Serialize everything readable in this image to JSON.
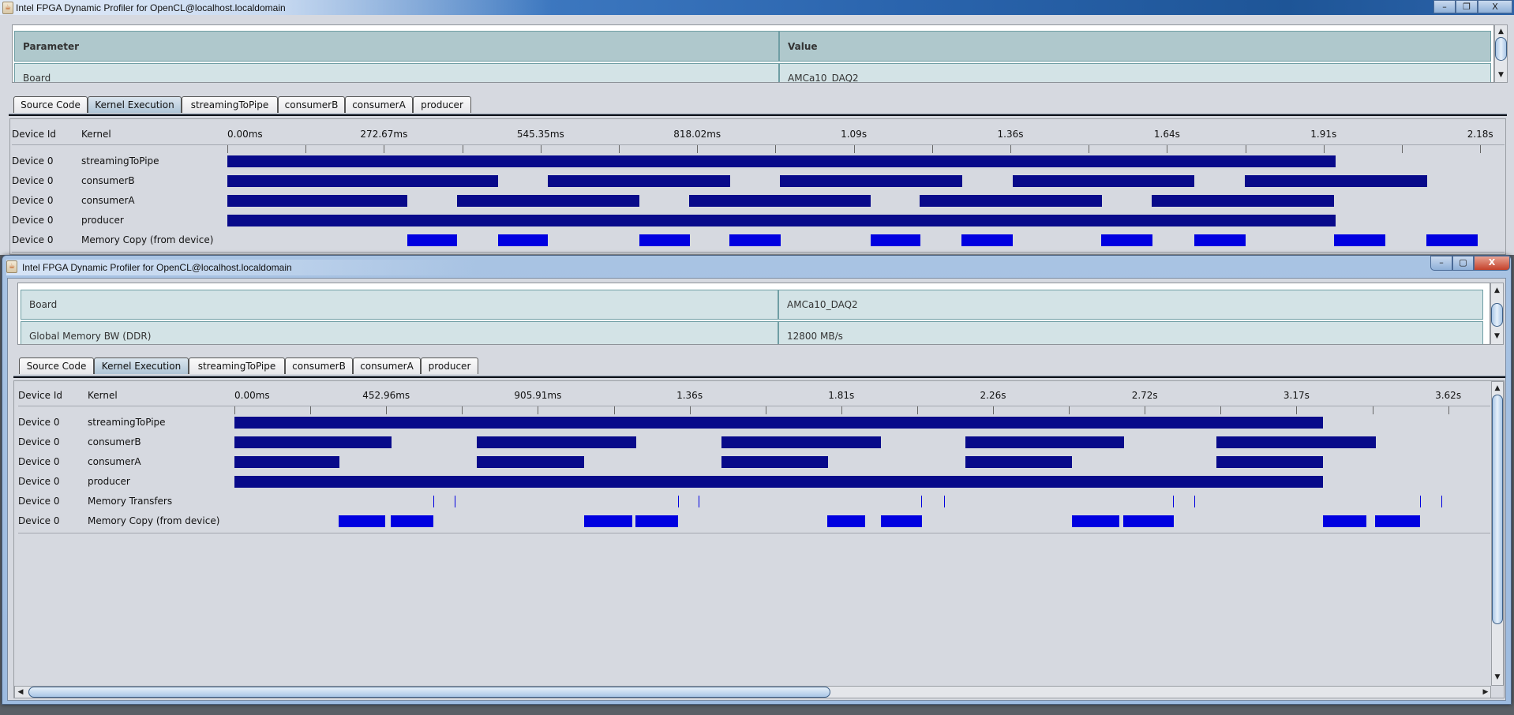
{
  "colors": {
    "kernel_bar": "#080a8a",
    "memory_bar": "#0000e0",
    "table_header": "#afc8cc",
    "table_row": "#d3e3e6"
  },
  "windows": [
    {
      "title": "Intel FPGA Dynamic Profiler for OpenCL@localhost.localdomain",
      "controls": {
        "minimize": "–",
        "maximize": "❐",
        "close": "X"
      },
      "table": {
        "headers": [
          "Parameter",
          "Value"
        ],
        "rows": [
          [
            "Board",
            "AMCa10_DAQ2"
          ]
        ]
      },
      "tabs": [
        {
          "label": "Source Code",
          "active": false
        },
        {
          "label": "Kernel Execution",
          "active": true
        },
        {
          "label": "streamingToPipe",
          "active": false
        },
        {
          "label": "consumerB",
          "active": false
        },
        {
          "label": "consumerA",
          "active": false
        },
        {
          "label": "producer",
          "active": false
        }
      ],
      "timeline": {
        "col_device": "Device Id",
        "col_kernel": "Kernel",
        "tick_ms": 136.335,
        "tick_count": 16,
        "axis_labels": [
          "0.00ms",
          "272.67ms",
          "545.35ms",
          "818.02ms",
          "1.09s",
          "1.36s",
          "1.64s",
          "1.91s",
          "2.18s"
        ],
        "rows": [
          {
            "device": "Device 0",
            "kernel": "streamingToPipe",
            "kind": "bar",
            "segments": [
              [
                0,
                1930
              ]
            ]
          },
          {
            "device": "Device 0",
            "kernel": "consumerB",
            "kind": "bar",
            "segments": [
              [
                0,
                472
              ],
              [
                558,
                875
              ],
              [
                962,
                1279
              ],
              [
                1367,
                1683
              ],
              [
                1771,
                2088
              ]
            ]
          },
          {
            "device": "Device 0",
            "kernel": "consumerA",
            "kind": "bar",
            "segments": [
              [
                0,
                314
              ],
              [
                400,
                717
              ],
              [
                804,
                1120
              ],
              [
                1205,
                1522
              ],
              [
                1610,
                1927
              ]
            ]
          },
          {
            "device": "Device 0",
            "kernel": "producer",
            "kind": "bar",
            "segments": [
              [
                0,
                1930
              ]
            ]
          },
          {
            "device": "Device 0",
            "kernel": "Memory Copy (from device)",
            "kind": "copy",
            "segments": [
              [
                314,
                401
              ],
              [
                472,
                559
              ],
              [
                717,
                805
              ],
              [
                874,
                963
              ],
              [
                1120,
                1206
              ],
              [
                1278,
                1368
              ],
              [
                1522,
                1611
              ],
              [
                1683,
                1772
              ],
              [
                1927,
                2016
              ],
              [
                2088,
                2177
              ]
            ]
          }
        ]
      }
    },
    {
      "title": "Intel FPGA Dynamic Profiler for OpenCL@localhost.localdomain",
      "controls": {
        "minimize": "–",
        "maximize": "▢",
        "close": "X"
      },
      "table": {
        "rows": [
          [
            "Board",
            "AMCa10_DAQ2"
          ],
          [
            "Global Memory BW (DDR)",
            "12800 MB/s"
          ]
        ]
      },
      "tabs": [
        {
          "label": "Source Code",
          "active": false
        },
        {
          "label": "Kernel Execution",
          "active": true
        },
        {
          "label": "streamingToPipe",
          "active": false
        },
        {
          "label": "consumerB",
          "active": false
        },
        {
          "label": "consumerA",
          "active": false
        },
        {
          "label": "producer",
          "active": false
        }
      ],
      "timeline": {
        "col_device": "Device Id",
        "col_kernel": "Kernel",
        "tick_ms": 226.48,
        "tick_count": 16,
        "axis_labels": [
          "0.00ms",
          "452.96ms",
          "905.91ms",
          "1.36s",
          "1.81s",
          "2.26s",
          "2.72s",
          "3.17s",
          "3.62s"
        ],
        "rows": [
          {
            "device": "Device 0",
            "kernel": "streamingToPipe",
            "kind": "bar",
            "segments": [
              [
                0,
                3249
              ]
            ]
          },
          {
            "device": "Device 0",
            "kernel": "consumerB",
            "kind": "bar",
            "segments": [
              [
                0,
                469
              ],
              [
                724,
                1199
              ],
              [
                1454,
                1930
              ],
              [
                2182,
                2656
              ],
              [
                2931,
                3407
              ]
            ]
          },
          {
            "device": "Device 0",
            "kernel": "consumerA",
            "kind": "bar",
            "segments": [
              [
                0,
                313
              ],
              [
                724,
                1044
              ],
              [
                1454,
                1772
              ],
              [
                2182,
                2500
              ],
              [
                2931,
                3249
              ]
            ]
          },
          {
            "device": "Device 0",
            "kernel": "producer",
            "kind": "bar",
            "segments": [
              [
                0,
                3249
              ]
            ]
          },
          {
            "device": "Device 0",
            "kernel": "Memory Transfers",
            "kind": "xfer",
            "marks": [
              594,
              657,
              1324,
              1386,
              2050,
              2118,
              2802,
              2865,
              3539,
              3603
            ]
          },
          {
            "device": "Device 0",
            "kernel": "Memory Copy (from device)",
            "kind": "copy",
            "segments": [
              [
                311,
                450
              ],
              [
                466,
                594
              ],
              [
                1044,
                1188
              ],
              [
                1197,
                1324
              ],
              [
                1770,
                1883
              ],
              [
                1930,
                2052
              ],
              [
                2500,
                2641
              ],
              [
                2653,
                2804
              ],
              [
                3249,
                3379
              ],
              [
                3405,
                3539
              ]
            ]
          }
        ]
      }
    }
  ]
}
